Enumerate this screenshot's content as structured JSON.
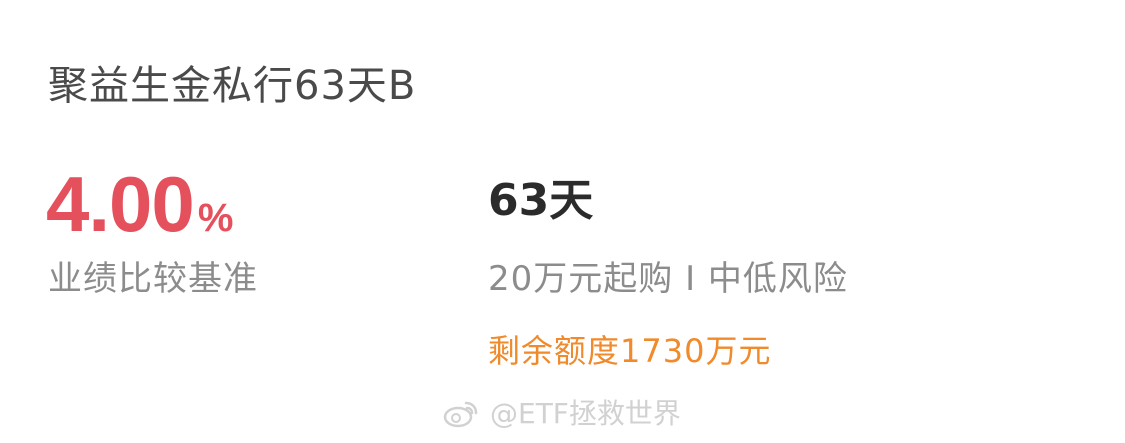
{
  "product": {
    "title": "聚益生金私行63天B",
    "rate_value": "4.00",
    "rate_unit": "%",
    "rate_label": "业绩比较基准",
    "term": "63天",
    "conditions": "20万元起购 I 中低风险",
    "quota": "剩余额度1730万元"
  },
  "watermark": {
    "text": "@ETF拯救世界",
    "icon": "weibo-icon"
  },
  "colors": {
    "rate": "#e5505d",
    "quota": "#f08a2a",
    "muted": "#8c8c8c",
    "title": "#4a4a4a",
    "watermark": "#cfcfcf"
  }
}
